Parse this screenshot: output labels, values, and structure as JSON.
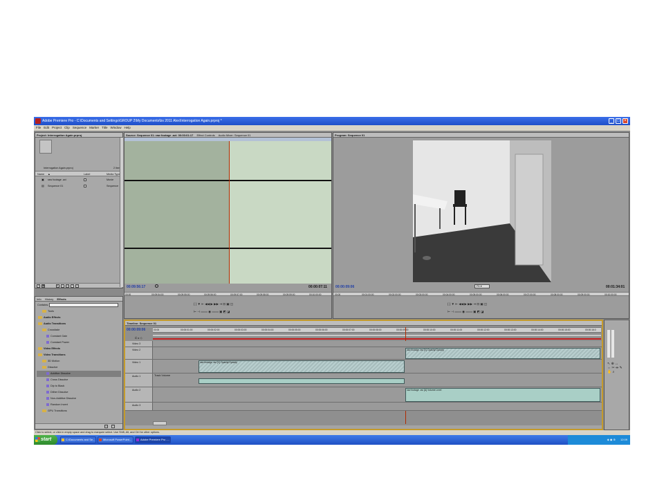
{
  "window": {
    "title": "Adobe Premiere Pro - C:\\Documents and Settings\\GROUP 2\\My Documents\\bs 2011 Alex\\Interrogation Again.prproj *",
    "menu": [
      "File",
      "Edit",
      "Project",
      "Clip",
      "Sequence",
      "Marker",
      "Title",
      "Window",
      "Help"
    ],
    "min": "_",
    "max": "□",
    "close": "×"
  },
  "project": {
    "tab": "Project: Interrogation Again.prproj",
    "filename": "Interrogation Again.prproj",
    "count": "2 Items",
    "col_name": "Name",
    "col_label": "Label",
    "col_media": "Media Type",
    "items": [
      {
        "name": "raw footage .avi",
        "type": "Movie"
      },
      {
        "name": "Sequence 01",
        "type": "Sequence"
      }
    ]
  },
  "source": {
    "tabs": [
      "Source: Sequence 01: raw footage .avi: 00:00:01:17",
      "Effect Controls",
      "Audio Mixer: Sequence 01"
    ],
    "timecode_left": "00:09:56:17",
    "timecode_right": "00:00:07:11",
    "ruler": [
      "00;00",
      "00:09:54:00",
      "00:09:55:00",
      "00:09:56:00",
      "00:09:57:00",
      "00:09:58:00",
      "00:09:59:00",
      "00:10:00:00"
    ]
  },
  "program": {
    "tab": "Program: Sequence 01",
    "timecode_left": "00:00:09:06",
    "timecode_right": "00:01:34:01",
    "zoom": "Fit",
    "ruler": [
      "00:00",
      "00:01:00:00",
      "00:02:00:00",
      "00:03:00:00",
      "00:04:00:00",
      "00:05:00:00",
      "00:06:00:00",
      "00:07:00:00",
      "00:08:00:00",
      "00:09:00:00",
      "00:10:00:00"
    ]
  },
  "effects": {
    "tabs": [
      "Info",
      "History",
      "Effects"
    ],
    "contains_label": "Contains:",
    "items": [
      {
        "label": "Tools",
        "kind": "folder",
        "indent": 1
      },
      {
        "label": "Audio Effects",
        "kind": "folder",
        "indent": 0
      },
      {
        "label": "Audio Transitions",
        "kind": "folder",
        "indent": 0
      },
      {
        "label": "Crossfade",
        "kind": "folder",
        "indent": 1
      },
      {
        "label": "Constant Gain",
        "kind": "fx",
        "indent": 2
      },
      {
        "label": "Constant Power",
        "kind": "fx",
        "indent": 2
      },
      {
        "label": "Video Effects",
        "kind": "folder",
        "indent": 0
      },
      {
        "label": "Video Transitions",
        "kind": "folder",
        "indent": 0
      },
      {
        "label": "3D Motion",
        "kind": "folder",
        "indent": 1
      },
      {
        "label": "Dissolve",
        "kind": "folder",
        "indent": 1
      },
      {
        "label": "Additive Dissolve",
        "kind": "fx",
        "indent": 2,
        "selected": true
      },
      {
        "label": "Cross Dissolve",
        "kind": "fx",
        "indent": 2
      },
      {
        "label": "Dip to Black",
        "kind": "fx",
        "indent": 2
      },
      {
        "label": "Dither Dissolve",
        "kind": "fx",
        "indent": 2
      },
      {
        "label": "Non-Additive Dissolve",
        "kind": "fx",
        "indent": 2
      },
      {
        "label": "Random Invert",
        "kind": "fx",
        "indent": 2
      },
      {
        "label": "GPU Transitions",
        "kind": "folder",
        "indent": 1
      }
    ]
  },
  "timeline": {
    "tab": "Timeline: Sequence 01",
    "timecode": "00:00:09:06",
    "ruler": [
      "00:00",
      "00:00:01:00",
      "00:00:02:00",
      "00:00:03:00",
      "00:00:04:00",
      "00:00:05:00",
      "00:00:06:00",
      "00:00:07:00",
      "00:00:08:00",
      "00:00:09:00",
      "00:00:10:00",
      "00:00:11:00",
      "00:00:12:00",
      "00:00:13:00",
      "00:00:14:00",
      "00:00:15:00",
      "00:00:16:0"
    ],
    "tracks": {
      "video3": "Video 3",
      "video2": "Video 2",
      "video1": "Video 1",
      "audio1": "Audio 1",
      "audio2": "Audio 2",
      "audio3": "Audio 3"
    },
    "track_volume": "Track Volume",
    "clips": {
      "v2": "raw footage .avi [V] Opacity:Opacity",
      "v1": "raw footage .avi [V] Opacity:Opacity",
      "a2": "raw footage .avi [A] Volume:Level"
    }
  },
  "status": "Click to select, or click in empty space and drag to marquee select. Use Shift, Alt, and Ctrl for other options.",
  "taskbar": {
    "start": "start",
    "items": [
      "C:\\Documents and Se...",
      "Microsoft PowerPoint...",
      "Adobe Premiere Pro -..."
    ],
    "clock": "12:09"
  }
}
